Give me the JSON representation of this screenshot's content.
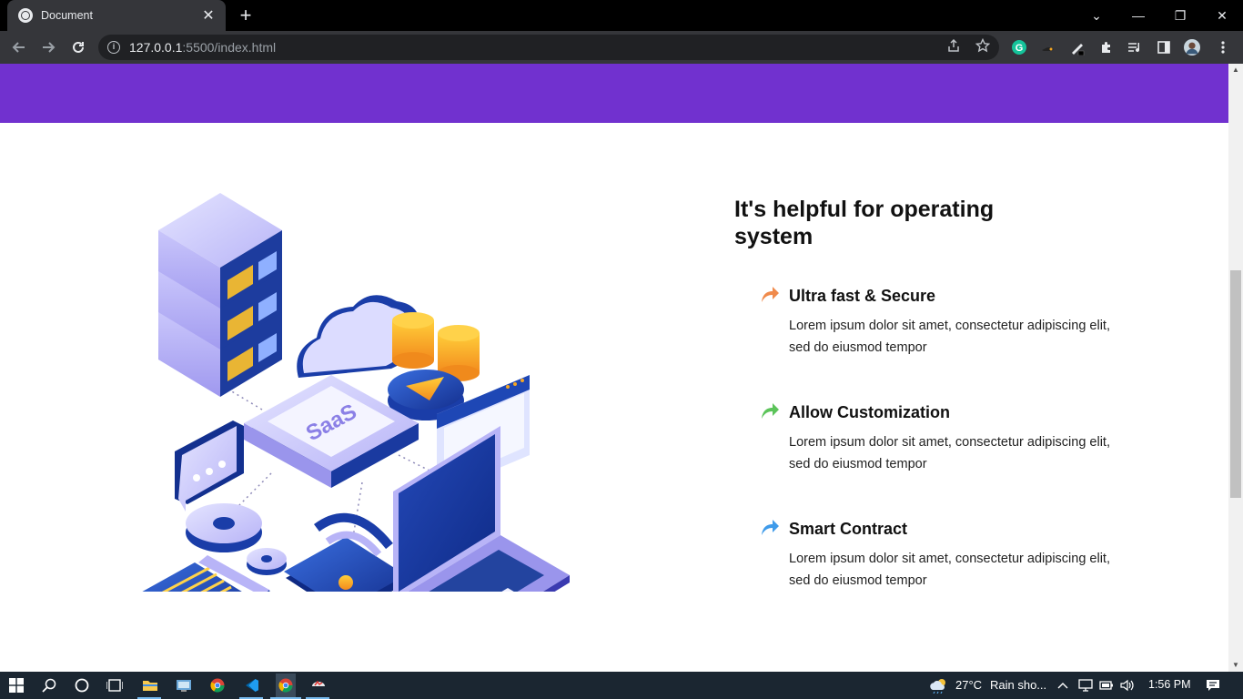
{
  "browser": {
    "tab_title": "Document",
    "tab_close": "✕",
    "new_tab": "+",
    "url_host": "127.0.0.1",
    "url_rest": ":5500/index.html",
    "window_controls": [
      "⌄",
      "—",
      "❐",
      "✕"
    ]
  },
  "page": {
    "illustration_label": "SaaS",
    "section_title": "It's helpful for operating system",
    "features": [
      {
        "title": "Ultra fast & Secure",
        "description": "Lorem ipsum dolor sit amet, consectetur adipiscing elit, sed do eiusmod tempor",
        "arrow_color": "#f08a4b"
      },
      {
        "title": "Allow Customization",
        "description": "Lorem ipsum dolor sit amet, consectetur adipiscing elit, sed do eiusmod tempor",
        "arrow_color": "#5cc45a"
      },
      {
        "title": "Smart Contract",
        "description": "Lorem ipsum dolor sit amet, consectetur adipiscing elit, sed do eiusmod tempor",
        "arrow_color": "#3f9bea"
      }
    ],
    "band_color": "#7131cf"
  },
  "taskbar": {
    "weather": "27°C",
    "weather_desc": "Rain sho...",
    "time": "1:56 PM"
  }
}
